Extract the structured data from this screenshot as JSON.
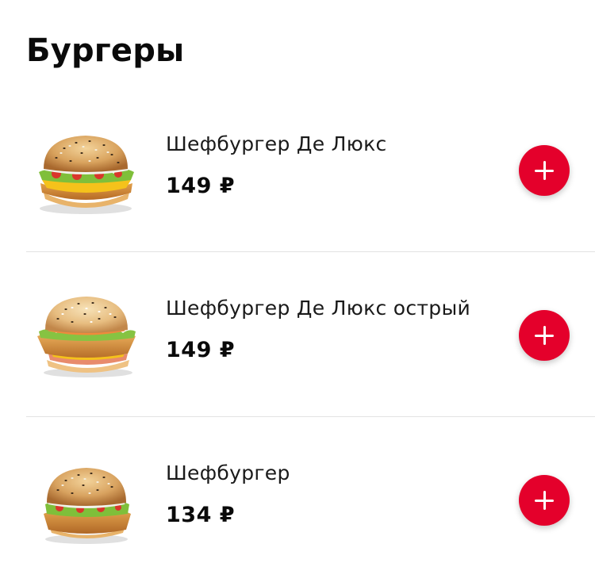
{
  "section": {
    "title": "Бургеры"
  },
  "colors": {
    "accent": "#e4002b",
    "text": "#111111",
    "divider": "#e2e2e2"
  },
  "products": [
    {
      "name": "Шефбургер Де Люкс",
      "price": "149 ₽",
      "image_icon": "burger-deluxe-photo",
      "add_icon": "plus-icon"
    },
    {
      "name": "Шефбургер Де Люкс острый",
      "price": "149 ₽",
      "image_icon": "burger-deluxe-spicy-photo",
      "add_icon": "plus-icon"
    },
    {
      "name": "Шефбургер",
      "price": "134 ₽",
      "image_icon": "burger-photo",
      "add_icon": "plus-icon"
    }
  ]
}
